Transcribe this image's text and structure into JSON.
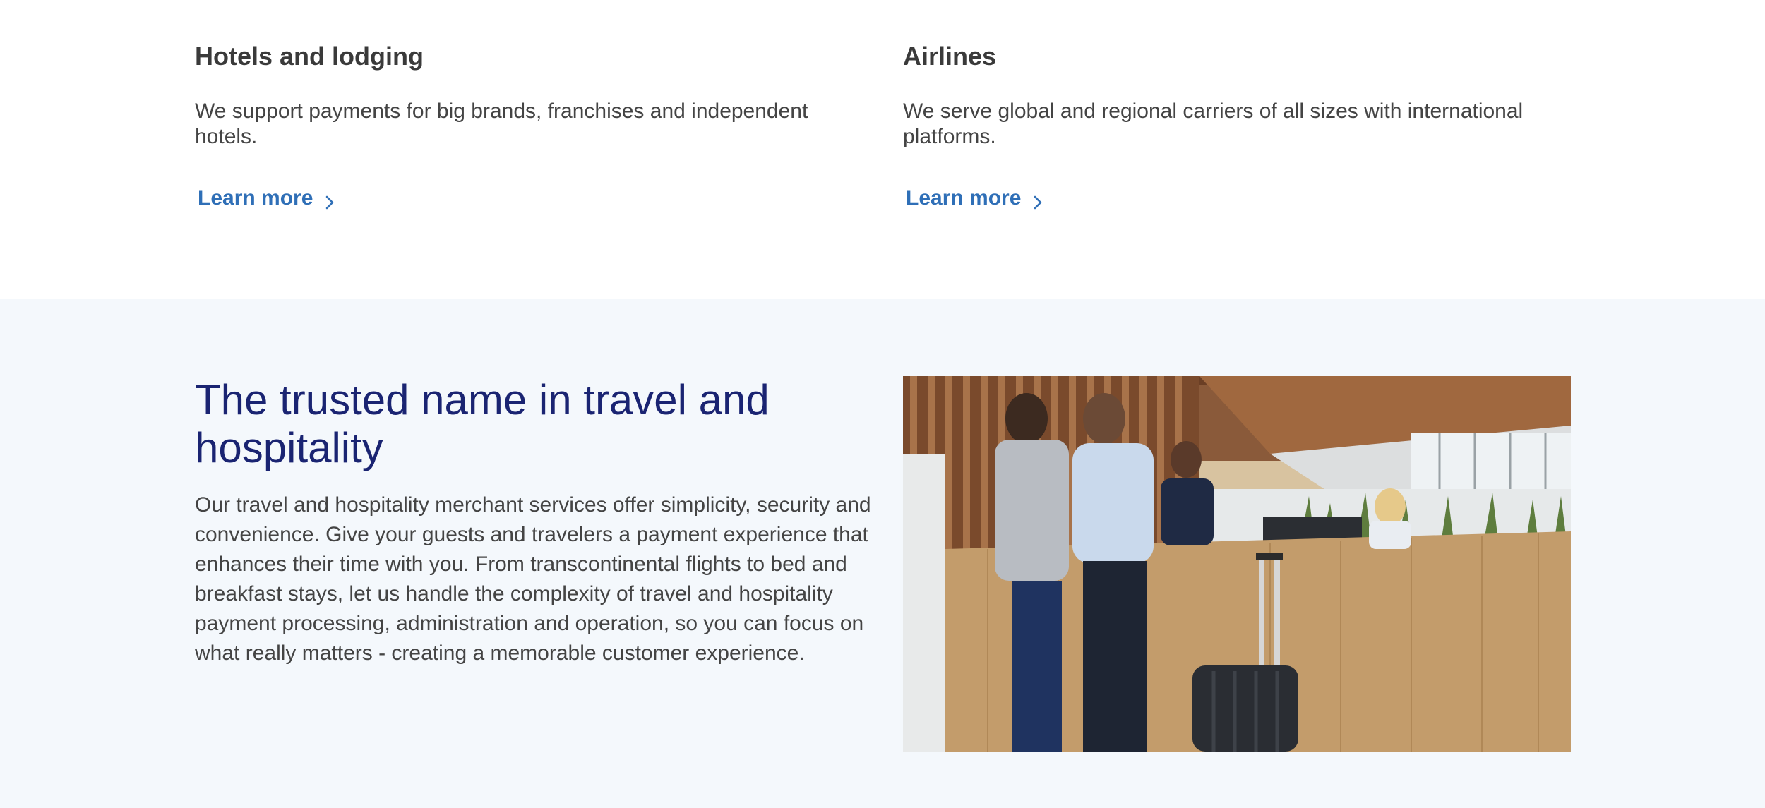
{
  "cards": [
    {
      "title": "Hotels and lodging",
      "description": "We support payments for big brands, franchises and independent hotels.",
      "link_label": "Learn more"
    },
    {
      "title": "Airlines",
      "description": "We serve global and regional carriers of all sizes with international platforms.",
      "link_label": "Learn more"
    }
  ],
  "feature": {
    "headline": "The trusted name in travel and hospitality",
    "body": "Our travel and hospitality merchant services offer simplicity, security and convenience. Give your guests and travelers a payment experience that enhances their time with you. From transcontinental flights to bed and breakfast stays, let us handle the complexity of travel and hospitality payment processing, administration and operation, so you can focus on what really matters - creating a memorable customer experience."
  },
  "colors": {
    "link": "#2f6fb7",
    "headline": "#1a2472",
    "band_background": "#f4f8fc"
  },
  "icons": {
    "link_arrow": "chevron-right-icon"
  }
}
